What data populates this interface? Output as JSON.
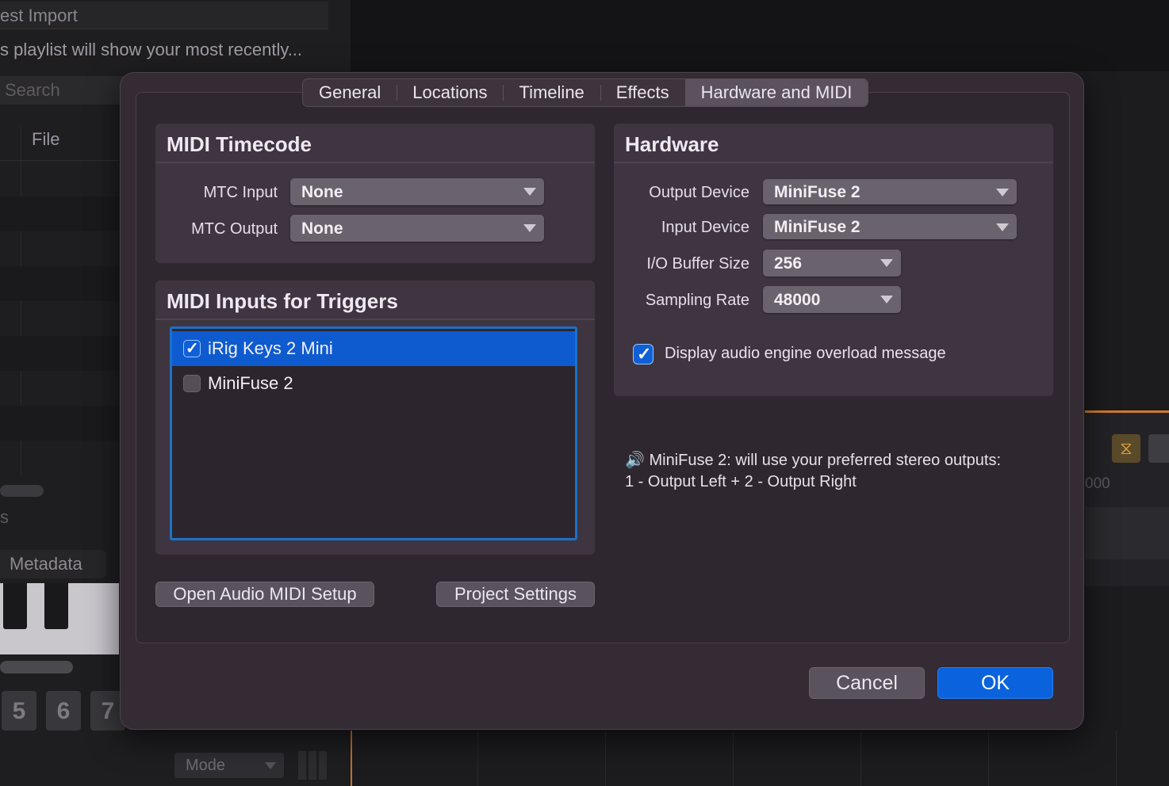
{
  "background": {
    "import_label": "est Import",
    "playlist_hint": "s playlist will show your most recently...",
    "search_placeholder": "Search",
    "file_column": "File",
    "s_label": "s",
    "metadata_label": "Metadata",
    "pads": [
      "5",
      "6",
      "7"
    ],
    "mode_label": "Mode",
    "ruler_text": "000"
  },
  "dialog": {
    "tabs": [
      {
        "label": "General"
      },
      {
        "label": "Locations"
      },
      {
        "label": "Timeline"
      },
      {
        "label": "Effects"
      },
      {
        "label": "Hardware and MIDI",
        "active": true
      }
    ],
    "midi_timecode": {
      "title": "MIDI Timecode",
      "mtc_input_label": "MTC Input",
      "mtc_input_value": "None",
      "mtc_output_label": "MTC Output",
      "mtc_output_value": "None"
    },
    "midi_triggers": {
      "title": "MIDI Inputs for Triggers",
      "items": [
        {
          "label": "iRig Keys 2 Mini",
          "checked": true,
          "selected": true
        },
        {
          "label": "MiniFuse 2",
          "checked": false,
          "selected": false
        }
      ]
    },
    "hardware": {
      "title": "Hardware",
      "output_device_label": "Output Device",
      "output_device_value": "MiniFuse 2",
      "input_device_label": "Input Device",
      "input_device_value": "MiniFuse 2",
      "buffer_size_label": "I/O Buffer Size",
      "buffer_size_value": "256",
      "sampling_rate_label": "Sampling Rate",
      "sampling_rate_value": "48000",
      "overload_message_label": "Display audio engine overload message",
      "overload_message_checked": true
    },
    "info": {
      "icon": "speaker-icon",
      "line1": "🔊 MiniFuse 2: will use your preferred stereo outputs:",
      "line2": "1 - Output Left + 2 - Output Right"
    },
    "buttons": {
      "open_audio_midi_setup": "Open Audio MIDI Setup",
      "project_settings": "Project Settings",
      "cancel": "Cancel",
      "ok": "OK"
    }
  },
  "colors": {
    "accent": "#0a63dc",
    "dialog_bg": "#342b34",
    "group_bg": "#3f3540"
  }
}
